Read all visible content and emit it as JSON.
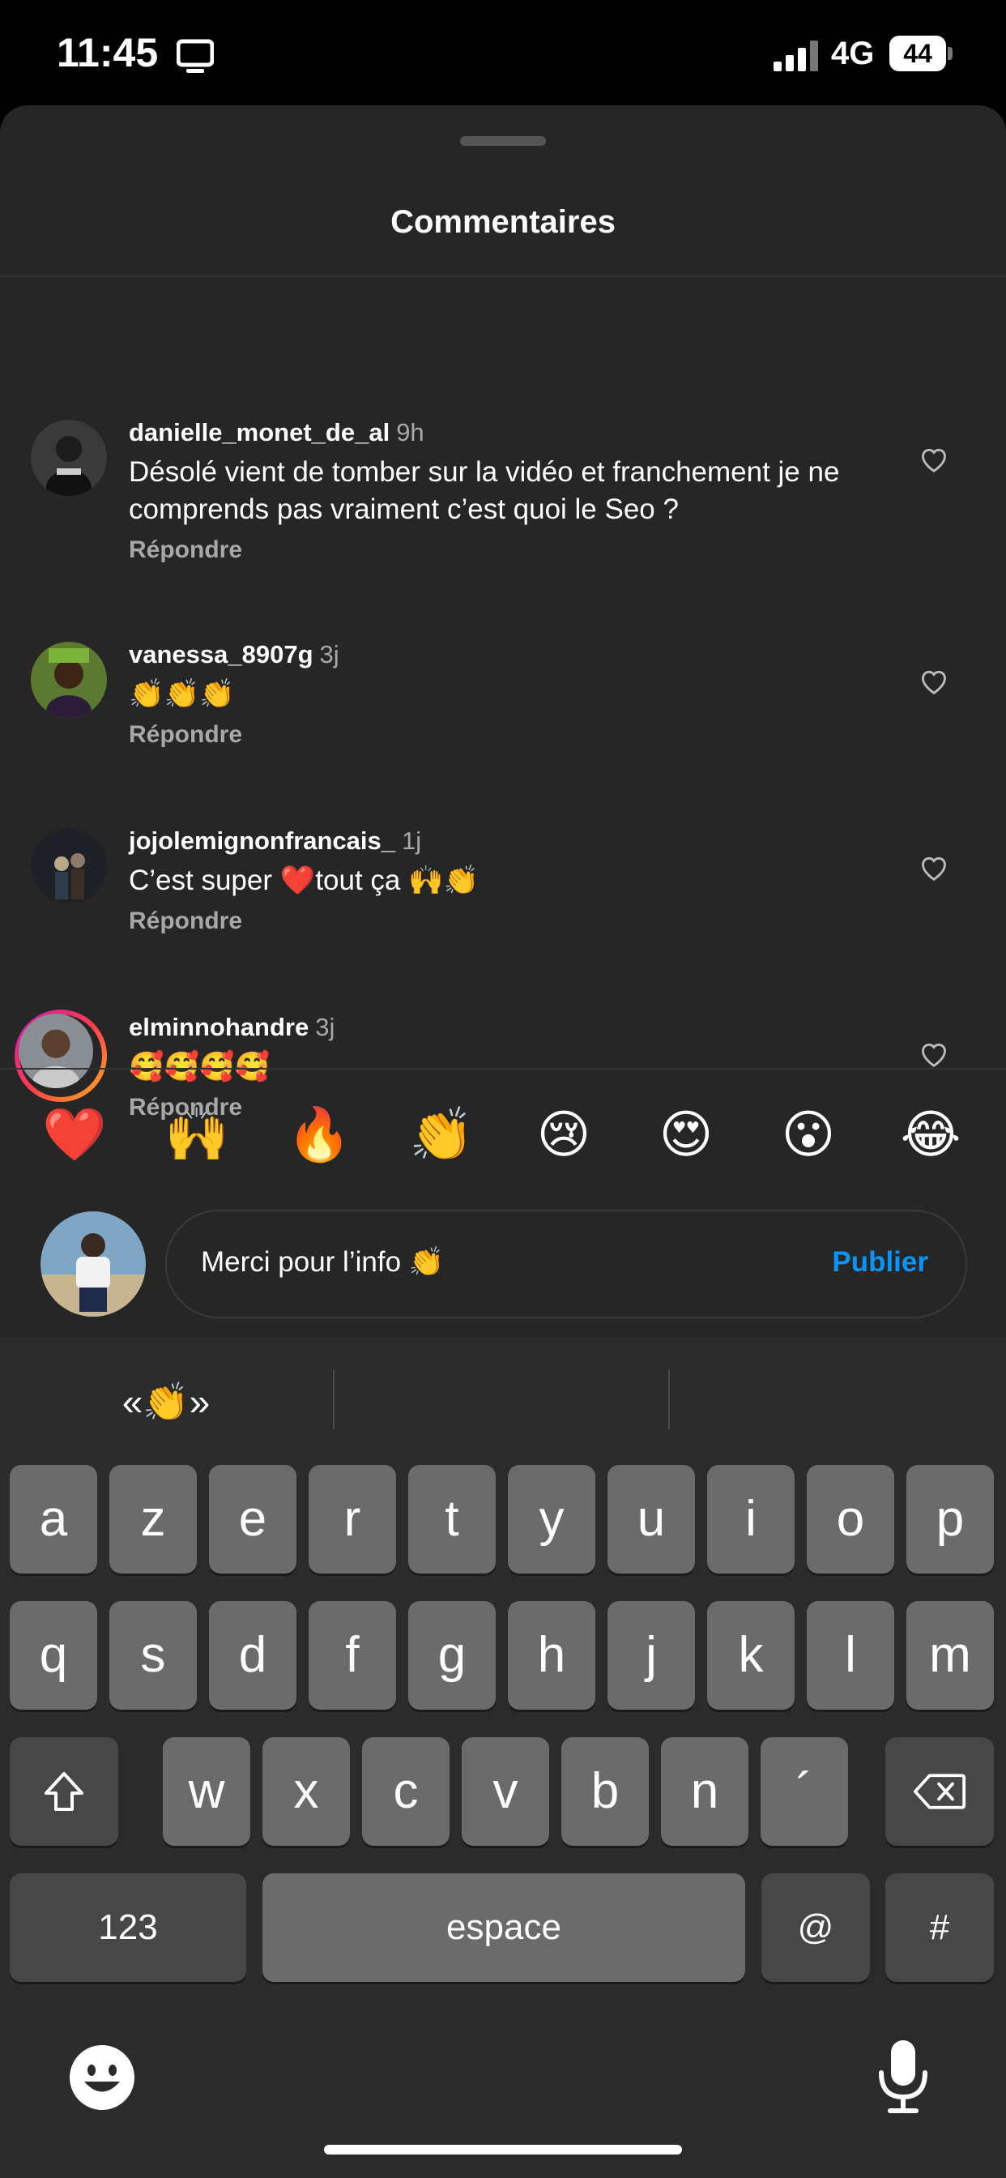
{
  "status": {
    "time": "11:45",
    "network": "4G",
    "battery": "44"
  },
  "sheet": {
    "title": "Commentaires"
  },
  "comments": [
    {
      "user": "danielle_monet_de_al",
      "time": "9h",
      "text": "Désolé vient de tomber sur la vidéo et franchement je ne comprends pas vraiment c’est quoi le Seo ?",
      "reply": "Répondre"
    },
    {
      "user": "vanessa_8907g",
      "time": "3j",
      "text": "👏👏👏",
      "reply": "Répondre"
    },
    {
      "user": "jojolemignonfrancais_",
      "time": "1j",
      "text": "C’est super ❤️tout ça 🙌👏",
      "reply": "Répondre"
    },
    {
      "user": "elminnohandre",
      "time": "3j",
      "text": "🥰🥰🥰🥰",
      "reply": "Répondre"
    }
  ],
  "quick_emojis": [
    "❤️",
    "🙌",
    "🔥",
    "👏",
    "😢",
    "😍",
    "😮",
    "😂"
  ],
  "composer": {
    "text": "Merci pour l’info 👏",
    "publish_label": "Publier"
  },
  "keyboard": {
    "suggestion": "«👏»",
    "row1": [
      "a",
      "z",
      "e",
      "r",
      "t",
      "y",
      "u",
      "i",
      "o",
      "p"
    ],
    "row2": [
      "q",
      "s",
      "d",
      "f",
      "g",
      "h",
      "j",
      "k",
      "l",
      "m"
    ],
    "row3": [
      "w",
      "x",
      "c",
      "v",
      "b",
      "n",
      "´"
    ],
    "numbers_label": "123",
    "space_label": "espace",
    "at_label": "@",
    "hash_label": "#"
  }
}
